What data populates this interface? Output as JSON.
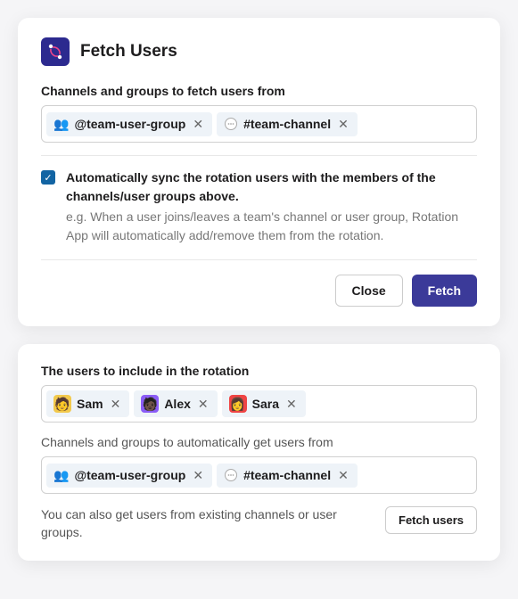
{
  "modal": {
    "title": "Fetch Users",
    "fieldLabel": "Channels and groups to fetch users from",
    "tokens": [
      {
        "kind": "group",
        "label": "@team-user-group"
      },
      {
        "kind": "channel",
        "label": "#team-channel"
      }
    ],
    "checkbox": {
      "checked": true,
      "label": "Automatically sync the rotation users with the members of the channels/user groups above.",
      "description": "e.g. When a user joins/leaves a team's channel or user group, Rotation App will automatically add/remove them from the rotation."
    },
    "actions": {
      "close": "Close",
      "fetch": "Fetch"
    }
  },
  "panel": {
    "usersLabel": "The users to include in the rotation",
    "users": [
      {
        "name": "Sam",
        "avatar": "sam"
      },
      {
        "name": "Alex",
        "avatar": "alex"
      },
      {
        "name": "Sara",
        "avatar": "sara"
      }
    ],
    "channelsLabel": "Channels and groups to automatically get users from",
    "tokens": [
      {
        "kind": "group",
        "label": "@team-user-group"
      },
      {
        "kind": "channel",
        "label": "#team-channel"
      }
    ],
    "hint": "You can also get users from existing channels or user groups.",
    "fetchButton": "Fetch users"
  }
}
